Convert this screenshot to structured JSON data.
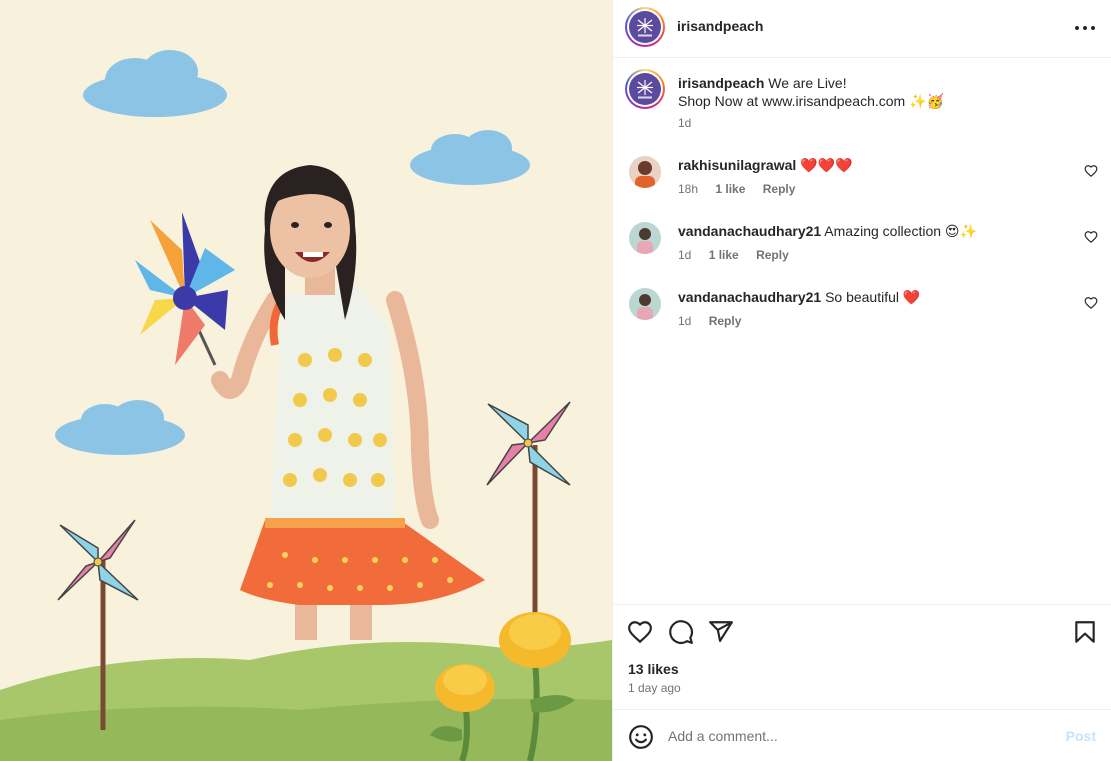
{
  "account": {
    "username": "irisandpeach"
  },
  "header": {
    "more_icon": "more-horizontal-icon"
  },
  "caption": {
    "username": "irisandpeach",
    "line1": "We are Live!",
    "line2": "Shop Now at www.irisandpeach.com",
    "line2_emoji": "✨🥳",
    "time": "1d"
  },
  "comments": [
    {
      "username": "rakhisunilagrawal",
      "text": "",
      "emoji": "❤️❤️❤️",
      "time": "18h",
      "likes": "1 like",
      "reply": "Reply"
    },
    {
      "username": "vandanachaudhary21",
      "text": "Amazing collection",
      "emoji": "😍✨",
      "time": "1d",
      "likes": "1 like",
      "reply": "Reply"
    },
    {
      "username": "vandanachaudhary21",
      "text": "So beautiful",
      "emoji": "❤️",
      "time": "1d",
      "likes": "",
      "reply": "Reply"
    }
  ],
  "actions": {
    "icons": [
      "heart-icon",
      "comment-icon",
      "share-icon",
      "bookmark-icon"
    ],
    "likes": "13 likes",
    "date": "1 day ago"
  },
  "composer": {
    "placeholder": "Add a comment...",
    "post_label": "Post",
    "post_color": "#c6e3fb"
  },
  "colors": {
    "media_bg": "#f8f1dc",
    "text": "#262626",
    "muted": "#737373",
    "avatar_brand": "#5b4a9e"
  }
}
